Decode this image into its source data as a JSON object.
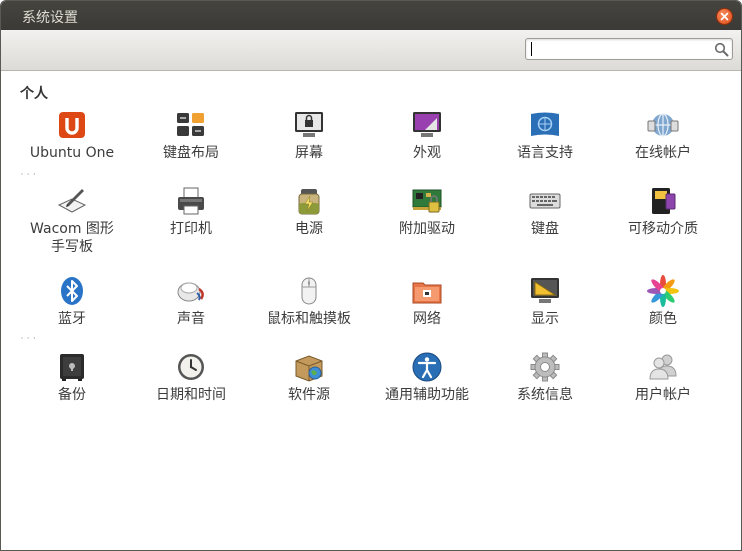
{
  "window": {
    "title": "系统设置"
  },
  "search": {
    "value": ""
  },
  "section": {
    "title": "个人"
  },
  "items": [
    {
      "label": "Ubuntu One"
    },
    {
      "label": "键盘布局"
    },
    {
      "label": "屏幕"
    },
    {
      "label": "外观"
    },
    {
      "label": "语言支持"
    },
    {
      "label": "在线帐户"
    },
    {
      "label": "Wacom 图形\n手写板"
    },
    {
      "label": "打印机"
    },
    {
      "label": "电源"
    },
    {
      "label": "附加驱动"
    },
    {
      "label": "键盘"
    },
    {
      "label": "可移动介质"
    },
    {
      "label": "蓝牙"
    },
    {
      "label": "声音"
    },
    {
      "label": "鼠标和触摸板"
    },
    {
      "label": "网络"
    },
    {
      "label": "显示"
    },
    {
      "label": "颜色"
    },
    {
      "label": "备份"
    },
    {
      "label": "日期和时间"
    },
    {
      "label": "软件源"
    },
    {
      "label": "通用辅助功能"
    },
    {
      "label": "系统信息"
    },
    {
      "label": "用户帐户"
    }
  ],
  "colors": {
    "titlebar": "#3c3b37",
    "close": "#e6571f",
    "accent_orange": "#dd4814"
  }
}
